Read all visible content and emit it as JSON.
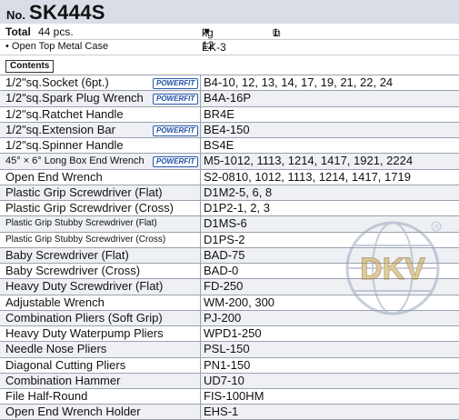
{
  "header": {
    "no_label": "No.",
    "model": "SK444S"
  },
  "summary": {
    "total_label": "Total",
    "total_value": "44 pcs.",
    "weight_value": "kg 12",
    "box_value": "1",
    "case_label": "• Open Top Metal Case",
    "case_code": "EK-3"
  },
  "contents_label": "Contents",
  "badge_text": "POWERFIT",
  "items": [
    {
      "name": "1/2\"sq.Socket (6pt.)",
      "code": "B4-10, 12, 13, 14, 17, 19, 21, 22, 24",
      "badge": true
    },
    {
      "name": "1/2\"sq.Spark Plug Wrench",
      "code": "B4A-16P",
      "badge": true
    },
    {
      "name": "1/2\"sq.Ratchet Handle",
      "code": "BR4E",
      "badge": false
    },
    {
      "name": "1/2\"sq.Extension Bar",
      "code": "BE4-150",
      "badge": true
    },
    {
      "name": "1/2\"sq.Spinner Handle",
      "code": "BS4E",
      "badge": false
    },
    {
      "name": "45° × 6° Long Box End Wrench",
      "code": "M5-1012, 1113, 1214, 1417, 1921, 2224",
      "badge": true
    },
    {
      "name": "Open End Wrench",
      "code": "S2-0810, 1012, 1113, 1214, 1417, 1719",
      "badge": false
    },
    {
      "name": "Plastic Grip Screwdriver (Flat)",
      "code": "D1M2-5, 6, 8",
      "badge": false
    },
    {
      "name": "Plastic Grip Screwdriver (Cross)",
      "code": "D1P2-1, 2, 3",
      "badge": false
    },
    {
      "name": "Plastic Grip Stubby Screwdriver (Flat)",
      "code": "D1MS-6",
      "badge": false
    },
    {
      "name": "Plastic Grip Stubby Screwdriver (Cross)",
      "code": "D1PS-2",
      "badge": false
    },
    {
      "name": "Baby Screwdriver (Flat)",
      "code": "BAD-75",
      "badge": false
    },
    {
      "name": "Baby Screwdriver (Cross)",
      "code": "BAD-0",
      "badge": false
    },
    {
      "name": "Heavy Duty Screwdriver (Flat)",
      "code": "FD-250",
      "badge": false
    },
    {
      "name": "Adjustable Wrench",
      "code": "WM-200, 300",
      "badge": false
    },
    {
      "name": "Combination Pliers (Soft Grip)",
      "code": "PJ-200",
      "badge": false
    },
    {
      "name": "Heavy Duty Waterpump Pliers",
      "code": "WPD1-250",
      "badge": false
    },
    {
      "name": "Needle Nose Pliers",
      "code": "PSL-150",
      "badge": false
    },
    {
      "name": "Diagonal Cutting Pliers",
      "code": "PN1-150",
      "badge": false
    },
    {
      "name": "Combination Hammer",
      "code": "UD7-10",
      "badge": false
    },
    {
      "name": "File Half-Round",
      "code": "FIS-100HM",
      "badge": false
    },
    {
      "name": "Open End Wrench Holder",
      "code": "EHS-1",
      "badge": false
    }
  ],
  "watermark_text": "DKV"
}
